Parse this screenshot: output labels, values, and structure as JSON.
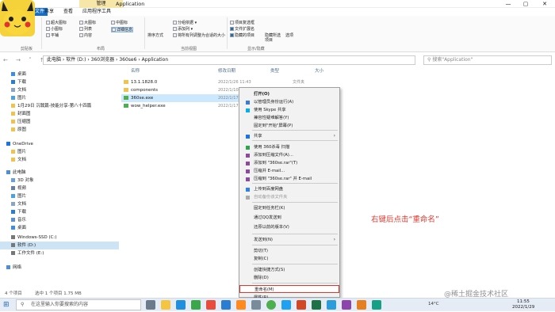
{
  "window": {
    "manage_tab": "管理",
    "title": "Application",
    "min": "—",
    "max": "▢",
    "close": "✕"
  },
  "ribbon_tabs": [
    "文件",
    "共享",
    "查看",
    "应用程序工具"
  ],
  "ribbon": {
    "g1_label": "剪贴板",
    "g2_items": [
      "超大图标",
      "大图标",
      "小图标",
      "列表",
      "平铺",
      "内容",
      "中图标",
      "详细信息"
    ],
    "g2_label": "布局",
    "sort_label": "排序方式",
    "g3_items": [
      "分组依据 ▾",
      "添加列 ▾",
      "将所有列调整为合适的大小"
    ],
    "g3_label": "当前视图",
    "g4_items": [
      "项目复选框",
      "文件扩展名",
      "隐藏的项目"
    ],
    "hide_label": "隐藏所选项目",
    "options_label": "选项",
    "g4_label": "显示/隐藏"
  },
  "address": {
    "path": "此电脑  ›  软件 (D:)  ›  360浏览器  ›  360se6  ›  Application",
    "search_placeholder": "搜索\"Application\""
  },
  "nav": [
    {
      "label": "桌面",
      "icon": "desktop-icon"
    },
    {
      "label": "下载",
      "icon": "download-icon"
    },
    {
      "label": "文档",
      "icon": "document-icon"
    },
    {
      "label": "图片",
      "icon": "picture-icon"
    },
    {
      "label": "1月29日 沉戟篇-技能分享-第八十四篇",
      "icon": "folder-icon"
    },
    {
      "label": "封面图",
      "icon": "folder-icon"
    },
    {
      "label": "压缩图",
      "icon": "folder-icon"
    },
    {
      "label": "原图",
      "icon": "folder-icon"
    },
    {
      "label": "OneDrive",
      "icon": "cloud-icon"
    },
    {
      "label": "图片",
      "icon": "folder-icon"
    },
    {
      "label": "文档",
      "icon": "folder-icon"
    },
    {
      "label": "此电脑",
      "icon": "computer-icon"
    },
    {
      "label": "3D 对象",
      "icon": "cube-icon"
    },
    {
      "label": "视频",
      "icon": "video-icon"
    },
    {
      "label": "图片",
      "icon": "picture-icon"
    },
    {
      "label": "文档",
      "icon": "document-icon"
    },
    {
      "label": "下载",
      "icon": "download-icon"
    },
    {
      "label": "音乐",
      "icon": "music-icon"
    },
    {
      "label": "桌面",
      "icon": "desktop-icon"
    },
    {
      "label": "Windows-SSD (C:)",
      "icon": "drive-icon"
    },
    {
      "label": "软件 (D:)",
      "icon": "drive-icon"
    },
    {
      "label": "工作文件 (E:)",
      "icon": "drive-icon"
    },
    {
      "label": "网络",
      "icon": "network-icon"
    }
  ],
  "columns": {
    "name": "名称",
    "date": "修改日期",
    "type": "类型",
    "size": "大小"
  },
  "files": [
    {
      "name": "13.1.1828.0",
      "date": "2022/1/26 11:43",
      "type": "文件夹"
    },
    {
      "name": "components",
      "date": "2022/1/10",
      "type": ""
    },
    {
      "name": "360se.exe",
      "date": "2022/1/17",
      "type": ""
    },
    {
      "name": "wow_helper.exe",
      "date": "2022/1/17",
      "type": ""
    }
  ],
  "context_menu": [
    {
      "label": "打开(O)",
      "bold": true
    },
    {
      "label": "以管理员身份运行(A)"
    },
    {
      "label": "使用 Skype 共享"
    },
    {
      "label": "兼容性疑难解答(Y)"
    },
    {
      "label": "固定到\"开始\"屏幕(P)"
    },
    {
      "label": "共享"
    },
    {
      "label": "使用 360杀毒 扫描"
    },
    {
      "label": "添加到压缩文件(A)..."
    },
    {
      "label": "添加到 \"360se.rar\"(T)"
    },
    {
      "label": "压缩并 E-mail..."
    },
    {
      "label": "压缩到 \"360se.rar\" 并 E-mail"
    },
    {
      "label": "上传到百度网盘"
    },
    {
      "label": "自动备份该文件夹"
    },
    {
      "label": "固定到任务栏(K)"
    },
    {
      "label": "通过QQ发送到"
    },
    {
      "label": "还原以前的版本(V)"
    },
    {
      "label": "发送到(N)"
    },
    {
      "label": "剪切(T)"
    },
    {
      "label": "复制(C)"
    },
    {
      "label": "创建快捷方式(S)"
    },
    {
      "label": "删除(D)"
    },
    {
      "label": "重命名(M)"
    },
    {
      "label": "属性(R)"
    }
  ],
  "annotation": "右键后点击“重命名”",
  "status": {
    "count": "4 个项目",
    "selected": "选中 1 个项目 1.75 MB"
  },
  "taskbar": {
    "search_placeholder": "在这里输入你要搜索的内容",
    "temp": "14°C",
    "time": "11:55",
    "date": "2022/1/29"
  },
  "watermark": "@稀土掘金技术社区",
  "colors": {
    "accent": "#0078d4",
    "highlight": "#e0342f",
    "selection": "#cce8ff"
  }
}
